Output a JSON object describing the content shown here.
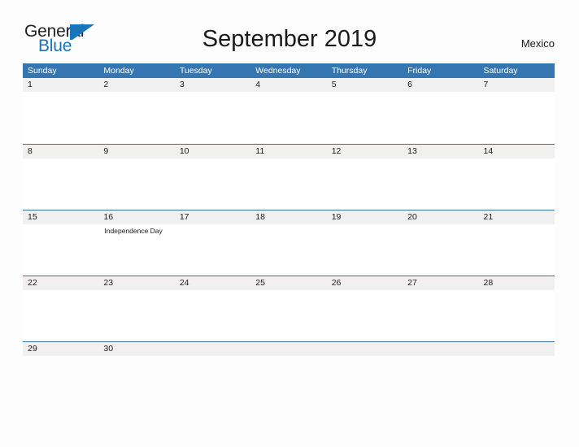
{
  "brand": {
    "name_part1": "General",
    "name_part2": "Blue",
    "triangle_color": "#1a75bb",
    "text_color": "#231f20"
  },
  "header": {
    "title": "September 2019",
    "region": "Mexico"
  },
  "theme": {
    "header_blue": "#3575b0",
    "day_strip_gray": "#f0f0f0",
    "page_background": "#fdfdfd",
    "text_dark": "#1a1a1a"
  },
  "calendar": {
    "weekdays": [
      "Sunday",
      "Monday",
      "Tuesday",
      "Wednesday",
      "Thursday",
      "Friday",
      "Saturday"
    ],
    "weeks": [
      {
        "days": [
          {
            "number": "1",
            "event": ""
          },
          {
            "number": "2",
            "event": ""
          },
          {
            "number": "3",
            "event": ""
          },
          {
            "number": "4",
            "event": ""
          },
          {
            "number": "5",
            "event": ""
          },
          {
            "number": "6",
            "event": ""
          },
          {
            "number": "7",
            "event": ""
          }
        ]
      },
      {
        "days": [
          {
            "number": "8",
            "event": ""
          },
          {
            "number": "9",
            "event": ""
          },
          {
            "number": "10",
            "event": ""
          },
          {
            "number": "11",
            "event": ""
          },
          {
            "number": "12",
            "event": ""
          },
          {
            "number": "13",
            "event": ""
          },
          {
            "number": "14",
            "event": ""
          }
        ]
      },
      {
        "days": [
          {
            "number": "15",
            "event": ""
          },
          {
            "number": "16",
            "event": "Independence Day"
          },
          {
            "number": "17",
            "event": ""
          },
          {
            "number": "18",
            "event": ""
          },
          {
            "number": "19",
            "event": ""
          },
          {
            "number": "20",
            "event": ""
          },
          {
            "number": "21",
            "event": ""
          }
        ]
      },
      {
        "days": [
          {
            "number": "22",
            "event": ""
          },
          {
            "number": "23",
            "event": ""
          },
          {
            "number": "24",
            "event": ""
          },
          {
            "number": "25",
            "event": ""
          },
          {
            "number": "26",
            "event": ""
          },
          {
            "number": "27",
            "event": ""
          },
          {
            "number": "28",
            "event": ""
          }
        ]
      },
      {
        "days": [
          {
            "number": "29",
            "event": ""
          },
          {
            "number": "30",
            "event": ""
          },
          {
            "number": "",
            "event": ""
          },
          {
            "number": "",
            "event": ""
          },
          {
            "number": "",
            "event": ""
          },
          {
            "number": "",
            "event": ""
          },
          {
            "number": "",
            "event": ""
          }
        ]
      }
    ]
  }
}
